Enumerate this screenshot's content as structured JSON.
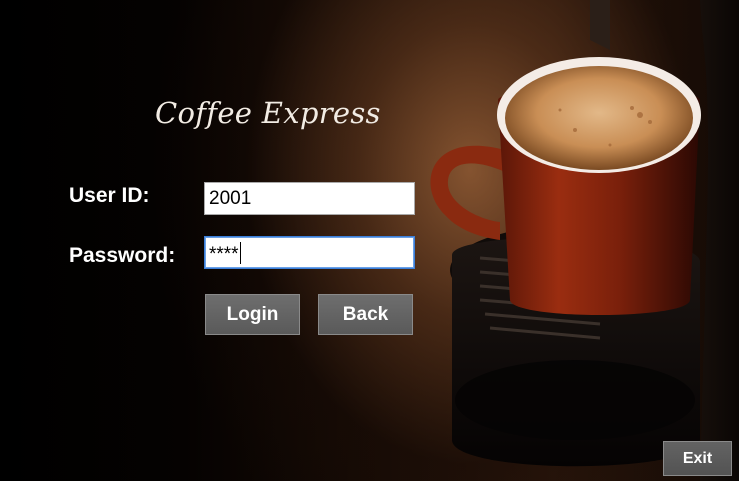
{
  "app": {
    "title": "Coffee Express"
  },
  "form": {
    "user_id_label": "User ID:",
    "user_id_value": "2001",
    "password_label": "Password:",
    "password_value": "****"
  },
  "buttons": {
    "login": "Login",
    "back": "Back",
    "exit": "Exit"
  },
  "colors": {
    "button_bg": "#5f5f5f",
    "focus_border": "#3c7fd9",
    "text": "#ffffff"
  }
}
